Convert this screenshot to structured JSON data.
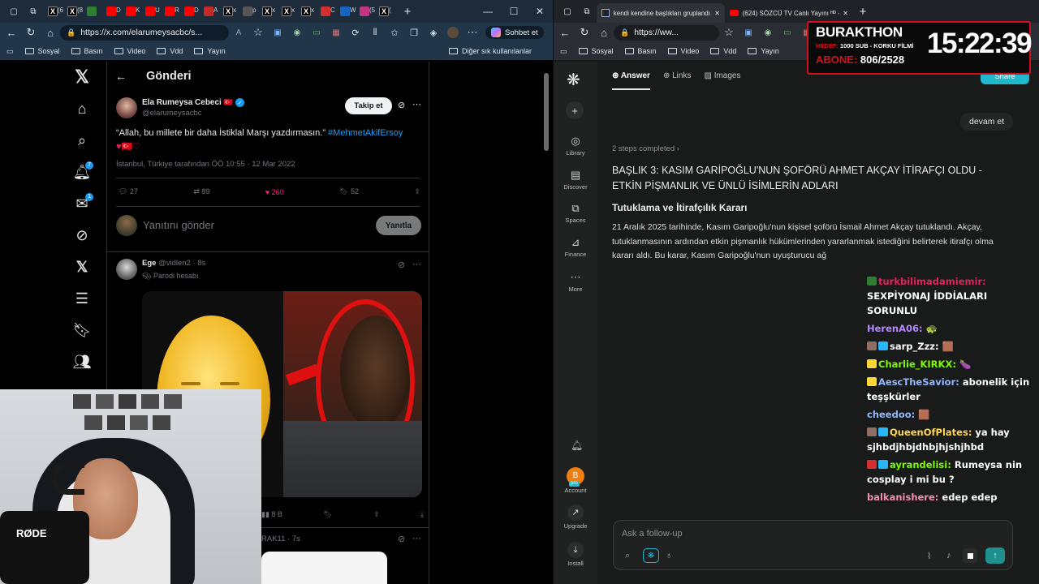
{
  "left_browser": {
    "tabs": [
      {
        "label": "(6",
        "icon": "x-logo-icon",
        "color": "#000000"
      },
      {
        "label": "(8",
        "icon": "x-logo-icon",
        "color": "#000000"
      },
      {
        "label": "",
        "icon": "game-icon",
        "color": "#2e7d32"
      },
      {
        "label": "D",
        "icon": "youtube-icon",
        "color": "#ff0000"
      },
      {
        "label": "K",
        "icon": "youtube-icon",
        "color": "#ff0000"
      },
      {
        "label": "U",
        "icon": "youtube-icon",
        "color": "#ff0000"
      },
      {
        "label": "R",
        "icon": "youtube-icon",
        "color": "#ff0000"
      },
      {
        "label": "D",
        "icon": "youtube-icon",
        "color": "#ff0000"
      },
      {
        "label": "A",
        "icon": "news-icon",
        "color": "#c62828"
      },
      {
        "label": "x",
        "icon": "x-logo-icon",
        "color": "#000000"
      },
      {
        "label": "p",
        "icon": "globe-icon",
        "color": "#555555"
      },
      {
        "label": "x",
        "icon": "x-logo-icon",
        "color": "#000000"
      },
      {
        "label": "x",
        "icon": "x-logo-icon",
        "color": "#000000"
      },
      {
        "label": "x",
        "icon": "x-logo-icon",
        "color": "#000000"
      },
      {
        "label": "C",
        "icon": "a-icon",
        "color": "#d32f2f"
      },
      {
        "label": "W",
        "icon": "copilot-icon",
        "color": "#1565c0"
      },
      {
        "label": "(5",
        "icon": "instagram-icon",
        "color": "#c13584"
      },
      {
        "label": "(",
        "icon": "x-logo-icon",
        "color": "#000000"
      }
    ],
    "url": "https://x.com/elarumeysacbc/s...",
    "sohbet_label": "Sohbet et",
    "bookmarks": [
      "Sosyal",
      "Basın",
      "Video",
      "Vdd",
      "Yayın"
    ],
    "other_bookmarks": "Diğer sık kullanılanlar"
  },
  "x_page": {
    "header_title": "Gönderi",
    "post": {
      "author_name": "Ela Rumeysa Cebeci",
      "author_flag": "🇹🇷",
      "author_handle": "@elarumeysacbc",
      "follow_label": "Takip et",
      "text": "“Allah, bu millete bir daha İstiklal Marşı yazdırmasın.”",
      "hashtag": "#MehmetAkifErsoy",
      "emojis": "♥🇹🇷♡",
      "meta": "İstanbul, Türkiye tarafından ÖÖ 10:55 · 12 Mar 2022",
      "replies": "27",
      "reposts": "89",
      "likes": "260",
      "bookmarks": "52"
    },
    "reply_placeholder": "Yanıtını gönder",
    "reply_button": "Yanıtla",
    "reply_post": {
      "author_name": "Ege",
      "author_handle": "@vidlen2",
      "time": "8s",
      "parody": "Parodi hesabı",
      "views": "8 B"
    },
    "next_post": {
      "author_fragment": "RAK11",
      "time": "7s"
    },
    "notification_badges": {
      "notifications": "7",
      "messages": "1"
    }
  },
  "right_browser": {
    "tabs": [
      {
        "label": "kendi kendine başlıkları gruplandı",
        "icon": "perplexity-icon"
      },
      {
        "label": "(624) SÖZCÜ TV Canlı Yayını ᴴᴰ - Y",
        "icon": "youtube-icon"
      }
    ],
    "url": "https://ww...",
    "bookmarks": [
      "Sosyal",
      "Basın",
      "Video",
      "Vdd",
      "Yayın"
    ]
  },
  "perplexity": {
    "sidebar": [
      "Library",
      "Discover",
      "Spaces",
      "Finance",
      "More",
      "Account",
      "Upgrade",
      "Install"
    ],
    "account_initial": "B",
    "account_badge": "pro",
    "tabs": [
      "Answer",
      "Links",
      "Images"
    ],
    "share_label": "Share",
    "user_query": "devam et",
    "steps": "2 steps completed",
    "heading": "BAŞLIK 3: KASIM GARİPOĞLU'NUN ŞOFÖRÜ AHMET AKÇAY İTİRAFÇI OLDU - ETKİN PİŞMANLIK VE ÜNLÜ İSİMLERİN ADLARI",
    "subheading": "Tutuklama ve İtirafçılık Kararı",
    "paragraph": "21 Aralık 2025 tarihinde, Kasım Garipoğlu'nun kişisel şoförü İsmail Ahmet Akçay tutuklandı. Akçay, tutuklanmasının ardından etkin pişmanlık hükümlerinden yararlanmak istediğini belirterek itirafçı olma kararı aldı. Bu karar, Kasım Garipoğlu'nun uyuşturucu ağ",
    "followup_placeholder": "Ask a follow-up"
  },
  "stream_overlay": {
    "title": "BURAKTHON",
    "goal_label": "HEDEF:",
    "goal_text": "1000 SUB - KORKU FİLMİ",
    "sub_label": "ABONE:",
    "sub_count": "806/2528",
    "timer": "15:22:39"
  },
  "chat": [
    {
      "user": "turkbilimadamiemir",
      "color": "#e0245e",
      "message": "SEXPİYONAJ İDDİALARI SORUNLU",
      "badges": [
        "#2e7d32"
      ]
    },
    {
      "user": "HerenA06",
      "color": "#b388ff",
      "message": "🐢",
      "badges": []
    },
    {
      "user": "sarp_Zzz",
      "color": "#ffffff",
      "message": "🟫",
      "badges": [
        "#8d6e63",
        "#29b6f6"
      ]
    },
    {
      "user": "Charlie_KIRKX",
      "color": "#7cfc00",
      "message": "🍆",
      "badges": [
        "#fdd835"
      ]
    },
    {
      "user": "AescTheSavior",
      "color": "#8fb8ff",
      "message": "abonelik için teşşkürler",
      "badges": [
        "#fdd835"
      ]
    },
    {
      "user": "cheedoo",
      "color": "#8fb8ff",
      "message": "🟫",
      "badges": []
    },
    {
      "user": "QueenOfPlates",
      "color": "#ffd54f",
      "message": "ya hay sjhbdjhbjdhbjhjshjhbd",
      "badges": [
        "#8d6e63",
        "#29b6f6"
      ]
    },
    {
      "user": "ayrandelisi",
      "color": "#7cfc00",
      "message": "Rumeysa nin cosplay i mi bu ?",
      "badges": [
        "#d32f2f",
        "#29b6f6"
      ]
    },
    {
      "user": "balkanishere",
      "color": "#f48fb1",
      "message": "edep edep",
      "badges": []
    }
  ],
  "webcam": {
    "mic_brand": "RØDE"
  },
  "colors": {
    "x_blue": "#1d9bf0",
    "like_pink": "#f91880",
    "overlay_red": "#d1101e",
    "pplx_teal": "#20b8cd"
  }
}
